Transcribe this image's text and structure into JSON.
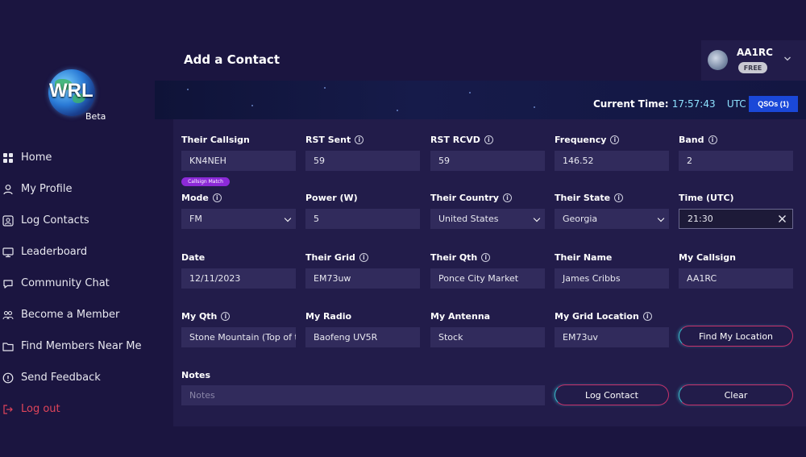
{
  "brand": {
    "logo_text": "WRL",
    "beta": "Beta"
  },
  "sidebar": {
    "items": [
      {
        "label": "Home",
        "icon": "grid-icon"
      },
      {
        "label": "My Profile",
        "icon": "user-icon"
      },
      {
        "label": "Log Contacts",
        "icon": "id-card-icon"
      },
      {
        "label": "Leaderboard",
        "icon": "monitor-icon"
      },
      {
        "label": "Community Chat",
        "icon": "chat-icon"
      },
      {
        "label": "Become a Member",
        "icon": "group-icon"
      },
      {
        "label": "Find Members Near Me",
        "icon": "folder-icon"
      },
      {
        "label": "Send Feedback",
        "icon": "alert-circle-icon"
      },
      {
        "label": "Log out",
        "icon": "logout-icon"
      }
    ]
  },
  "header": {
    "title": "Add a Contact",
    "user": {
      "name": "AA1RC",
      "plan": "FREE"
    }
  },
  "banner": {
    "current_time_label": "Current Time:",
    "current_time": "17:57:43",
    "tz": "UTC",
    "qsos_label": "QSOs (1)"
  },
  "form": {
    "their_callsign": {
      "label": "Their Callsign",
      "value": "KN4NEH",
      "badge": "Callsign Match"
    },
    "rst_sent": {
      "label": "RST Sent",
      "value": "59"
    },
    "rst_rcvd": {
      "label": "RST RCVD",
      "value": "59"
    },
    "frequency": {
      "label": "Frequency",
      "value": "146.52"
    },
    "band": {
      "label": "Band",
      "value": "2"
    },
    "mode": {
      "label": "Mode",
      "value": "FM"
    },
    "power": {
      "label": "Power (W)",
      "value": "5"
    },
    "their_country": {
      "label": "Their Country",
      "value": "United States"
    },
    "their_state": {
      "label": "Their State",
      "value": "Georgia"
    },
    "time_utc": {
      "label": "Time (UTC)",
      "value": "21:30"
    },
    "date": {
      "label": "Date",
      "value": "12/11/2023"
    },
    "their_grid": {
      "label": "Their Grid",
      "value": "EM73uw"
    },
    "their_qth": {
      "label": "Their Qth",
      "value": "Ponce City Market"
    },
    "their_name": {
      "label": "Their Name",
      "value": "James Cribbs"
    },
    "my_callsign": {
      "label": "My Callsign",
      "value": "AA1RC"
    },
    "my_qth": {
      "label": "My Qth",
      "value": "Stone Mountain (Top of th"
    },
    "my_radio": {
      "label": "My Radio",
      "value": "Baofeng UV5R"
    },
    "my_antenna": {
      "label": "My Antenna",
      "value": "Stock"
    },
    "my_grid": {
      "label": "My Grid Location",
      "value": "EM73uv"
    },
    "notes": {
      "label": "Notes",
      "placeholder": "Notes"
    },
    "buttons": {
      "find_location": "Find My Location",
      "log_contact": "Log Contact",
      "clear": "Clear"
    }
  },
  "colors": {
    "background": "#1b1540",
    "panel": "#221c4a",
    "input": "#312b5c",
    "accent_blue": "#1a48d8",
    "badge_purple": "#8c2ad8",
    "logout_red": "#e0445a",
    "time_cyan": "#8ee2ff"
  }
}
